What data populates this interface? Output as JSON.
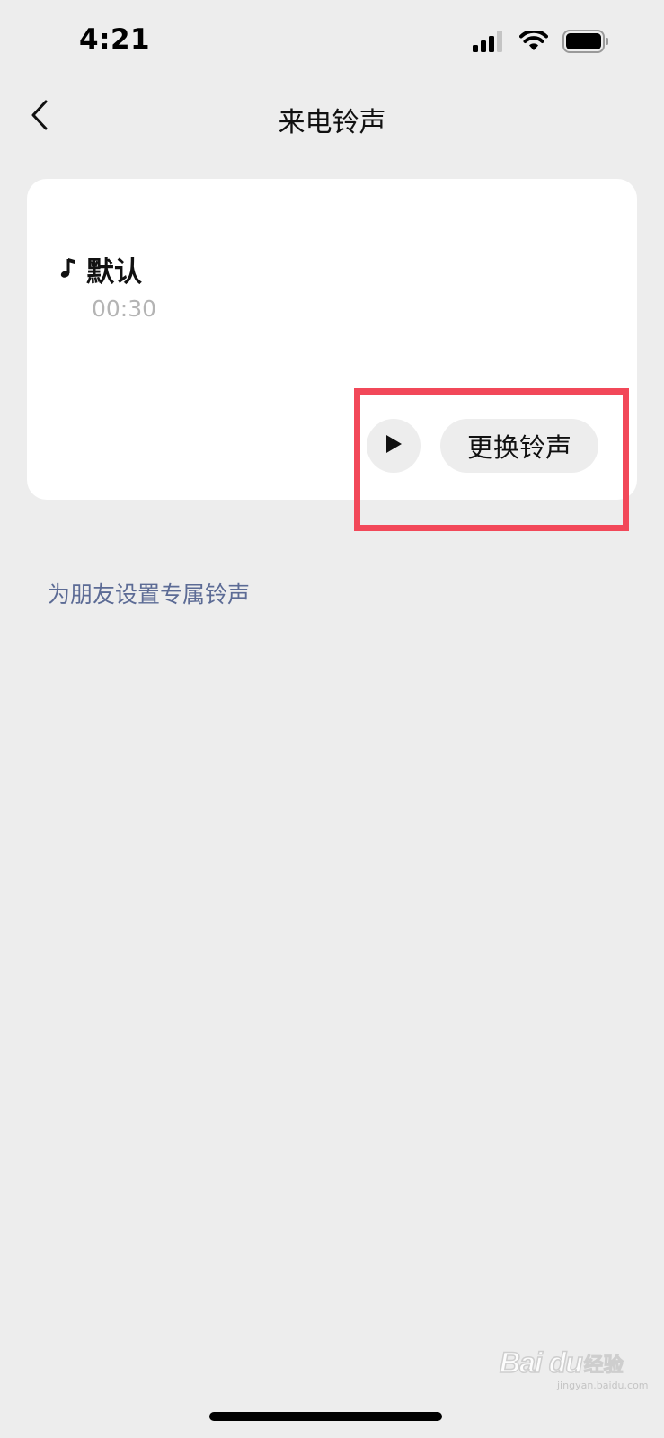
{
  "status_bar": {
    "time": "4:21",
    "icons": [
      "signal-icon",
      "wifi-icon",
      "battery-icon"
    ]
  },
  "nav": {
    "back_icon": "chevron-left-icon",
    "title": "来电铃声"
  },
  "ringtone": {
    "icon": "music-note-icon",
    "name": "默认",
    "duration": "00:30"
  },
  "actions": {
    "play_icon": "play-icon",
    "change_label": "更换铃声"
  },
  "friend_link": "为朋友设置专属铃声",
  "watermark": {
    "brand": "Bai du",
    "suffix": "经验",
    "url": "jingyan.baidu.com"
  },
  "colors": {
    "background": "#ededed",
    "card": "#ffffff",
    "link": "#5c6b95",
    "highlight": "#f24859",
    "secondary_text": "#b4b4b4"
  }
}
